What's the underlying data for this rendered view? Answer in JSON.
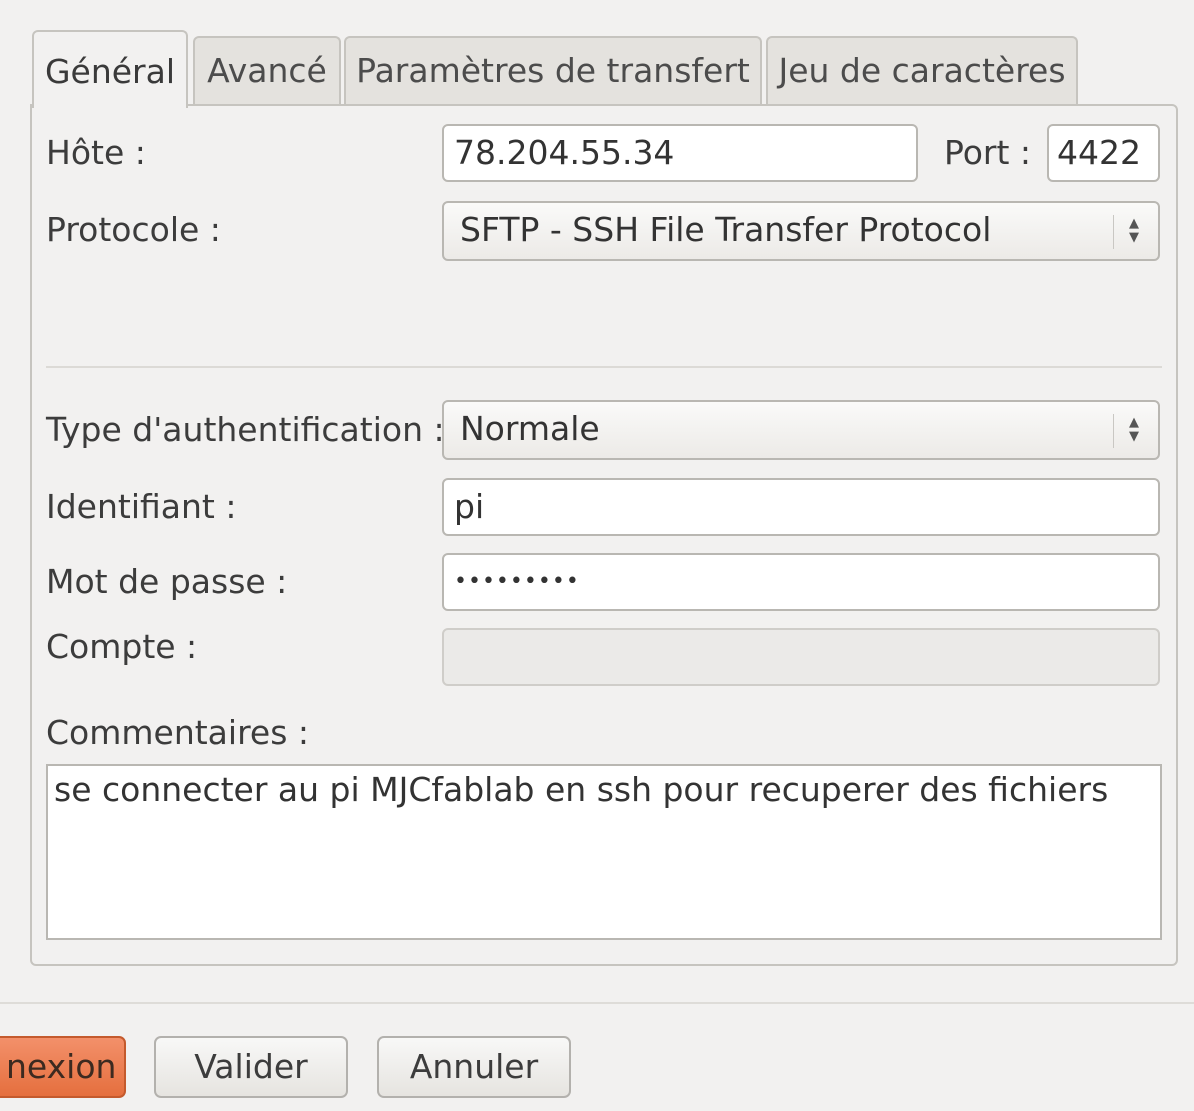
{
  "tabs": [
    {
      "label": "Général",
      "active": true
    },
    {
      "label": "Avancé",
      "active": false
    },
    {
      "label": "Paramètres de transfert",
      "active": false
    },
    {
      "label": "Jeu de caractères",
      "active": false
    }
  ],
  "general": {
    "host_label": "Hôte :",
    "host_value": "78.204.55.34",
    "port_label": "Port :",
    "port_value": "4422",
    "protocol_label": "Protocole :",
    "protocol_value": "SFTP - SSH File Transfer Protocol",
    "auth_label": "Type d'authentification :",
    "auth_value": "Normale",
    "user_label": "Identifiant :",
    "user_value": "pi",
    "password_label": "Mot de passe :",
    "password_value": "•••••••••",
    "account_label": "Compte :",
    "account_value": "",
    "comments_label": "Commentaires :",
    "comments_value": "se connecter au pi MJCfablab en ssh pour recuperer des fichiers"
  },
  "buttons": {
    "connect_label": "nexion",
    "ok_label": "Valider",
    "cancel_label": "Annuler"
  },
  "colors": {
    "accent": "#e8784a",
    "background": "#f2f1f0"
  },
  "icons": {
    "combo_arrows": "spin-updown-icon"
  }
}
